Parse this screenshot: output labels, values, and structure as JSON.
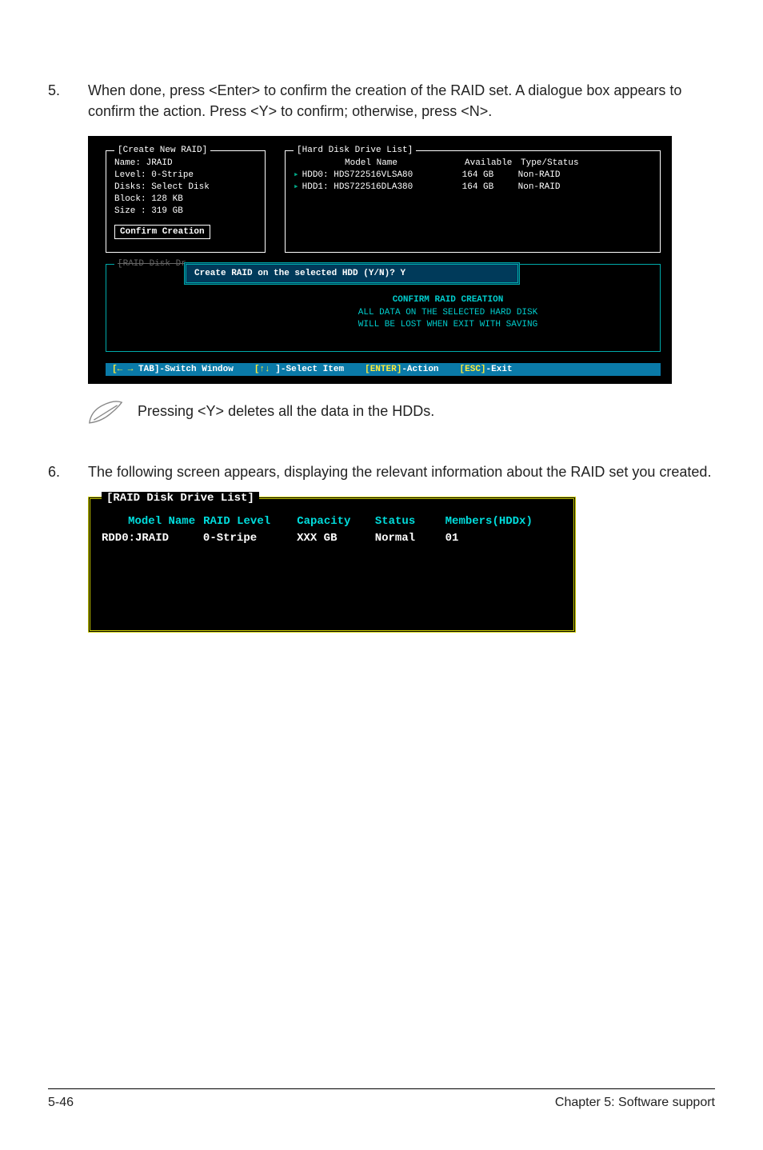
{
  "steps": {
    "s5": {
      "num": "5.",
      "text": "When done, press <Enter> to confirm the creation of the RAID set. A dialogue box appears to confirm the action. Press <Y> to confirm; otherwise, press <N>."
    },
    "s6": {
      "num": "6.",
      "text": "The following screen appears, displaying the relevant information about the RAID set you created."
    }
  },
  "note": {
    "text": "Pressing <Y> deletes all the data in the HDDs."
  },
  "bios1": {
    "create_panel": {
      "title": "[Create New RAID]",
      "lines": {
        "l1": "Name: JRAID",
        "l2": "Level: 0-Stripe",
        "l3": "Disks: Select Disk",
        "l4": "Block: 128 KB",
        "l5": "Size : 319 GB"
      },
      "confirm": "Confirm Creation"
    },
    "hdd_panel": {
      "title": "[Hard Disk Drive List]",
      "head": {
        "model": "Model Name",
        "avail": "Available",
        "type": "Type/Status"
      },
      "rows": [
        {
          "name": "HDD0: HDS722516VLSA80",
          "avail": "164 GB",
          "type": "Non-RAID"
        },
        {
          "name": "HDD1: HDS722516DLA380",
          "avail": "164 GB",
          "type": "Non-RAID"
        }
      ]
    },
    "lower_title": "[RAID Disk Dr",
    "prompt": {
      "q": "Create RAID on the selected HDD (Y/N)?",
      "a": "Y"
    },
    "warn": {
      "title": "CONFIRM RAID CREATION",
      "l1": "ALL DATA ON THE SELECTED HARD DISK",
      "l2": "WILL BE LOST WHEN EXIT WITH SAVING"
    },
    "footer": {
      "tab": "TAB]-Switch Window",
      "tab_prefix": "[← →",
      "sel_prefix": "[↑↓",
      "sel": "]-Select Item",
      "enter": "[ENTER]-Action",
      "esc": "[ESC]-Exit"
    }
  },
  "bios2": {
    "title": "[RAID Disk Drive List]",
    "head": {
      "model": "Model Name",
      "level": "RAID Level",
      "cap": "Capacity",
      "status": "Status",
      "members": "Members(HDDx)"
    },
    "row": {
      "model": "RDD0:JRAID",
      "level": "0-Stripe",
      "cap": "XXX GB",
      "status": "Normal",
      "members": "01"
    }
  },
  "pagefoot": {
    "left": "5-46",
    "right": "Chapter 5: Software support"
  }
}
